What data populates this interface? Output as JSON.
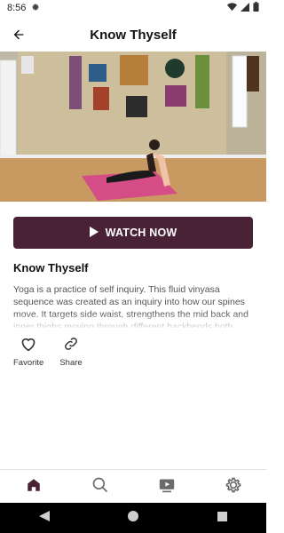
{
  "status_bar": {
    "time": "8:56",
    "left_icon": "settings-gear-icon",
    "right_icons": [
      "wifi-icon",
      "signal-icon",
      "battery-icon"
    ]
  },
  "header": {
    "title": "Know Thyself",
    "back_icon": "back-arrow-icon"
  },
  "hero": {
    "image": "yoga-room-photo"
  },
  "cta": {
    "label": "WATCH NOW",
    "icon": "play-icon",
    "color": "#4a2235"
  },
  "content": {
    "title": "Know Thyself",
    "description": "Yoga is a practice of self inquiry. This fluid vinyasa sequence was created as an inquiry into how our spines move. It targets side waist, strengthens the mid back and inner thighs moving through different backbends both"
  },
  "actions": [
    {
      "label": "Favorite",
      "icon": "heart-outline-icon"
    },
    {
      "label": "Share",
      "icon": "link-icon"
    }
  ],
  "bottom_nav": [
    {
      "icon": "home-icon",
      "active": true
    },
    {
      "icon": "search-icon",
      "active": false
    },
    {
      "icon": "video-icon",
      "active": false
    },
    {
      "icon": "settings-icon",
      "active": false
    }
  ],
  "system_nav": [
    "back-triangle-icon",
    "home-circle-icon",
    "recents-square-icon"
  ]
}
